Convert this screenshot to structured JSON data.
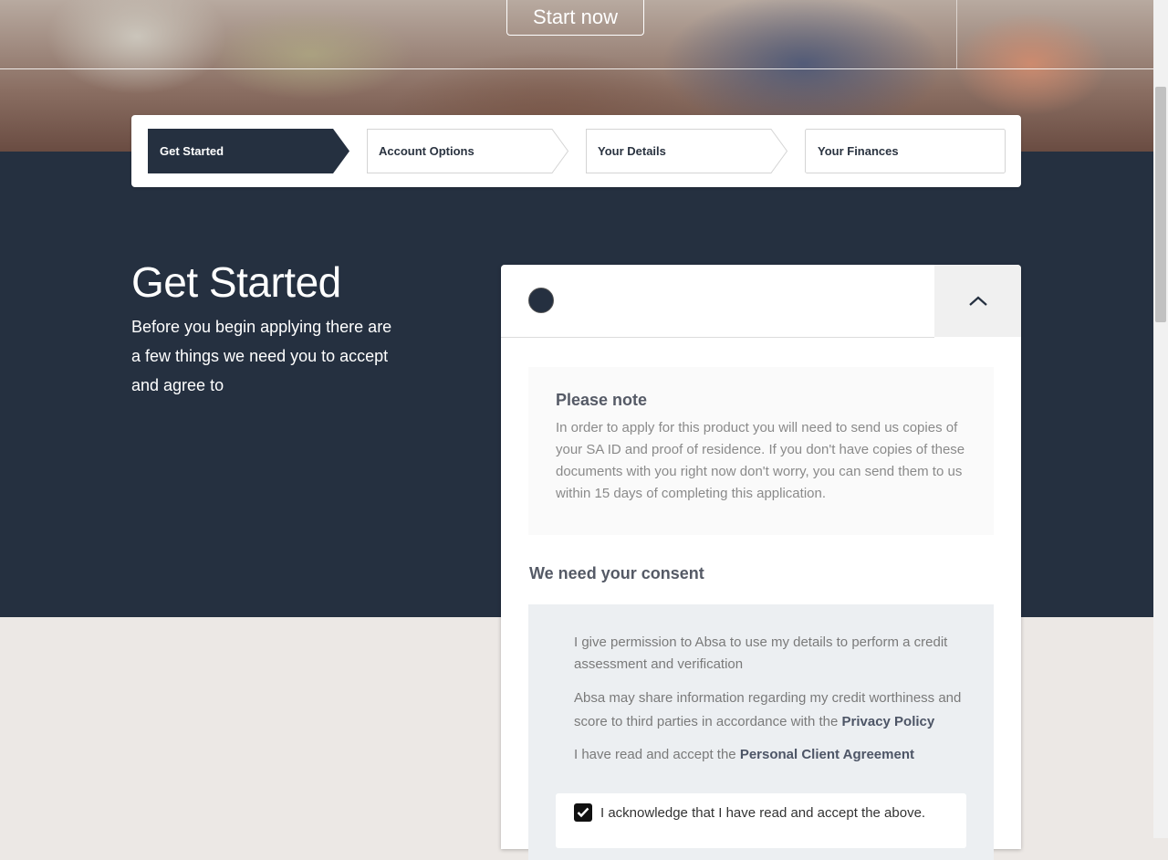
{
  "hero": {
    "cta_label": "Start now"
  },
  "stepper": {
    "steps": [
      {
        "label": "Get Started",
        "active": true
      },
      {
        "label": "Account Options",
        "active": false
      },
      {
        "label": "Your Details",
        "active": false
      },
      {
        "label": "Your Finances",
        "active": false
      }
    ]
  },
  "intro": {
    "title": "Get Started",
    "subtitle": "Before you begin applying there are a few things we need you to accept and agree to"
  },
  "card": {
    "collapse_icon": "chevron-up-icon",
    "note": {
      "title": "Please note",
      "body": "In order to apply for this product you will need to send us copies of your SA ID and proof of residence. If you don't have copies of these documents with you right now don't worry, you can send them to us within 15 days of completing this application."
    },
    "consent": {
      "title": "We need your consent",
      "permission": "I give permission to Absa to use my details to perform a credit assessment and verification",
      "share_prefix": "Absa may share information regarding my credit worthiness and score to third parties in accordance with the",
      "privacy_link": "Privacy Policy",
      "agreement_prefix": "I have read and accept the",
      "agreement_link": "Personal Client Agreement",
      "acknowledge_label": "I acknowledge that I have read and accept the above.",
      "acknowledge_checked": true
    }
  },
  "colors": {
    "primary_dark": "#253040",
    "page_bg": "#ece8e5"
  }
}
